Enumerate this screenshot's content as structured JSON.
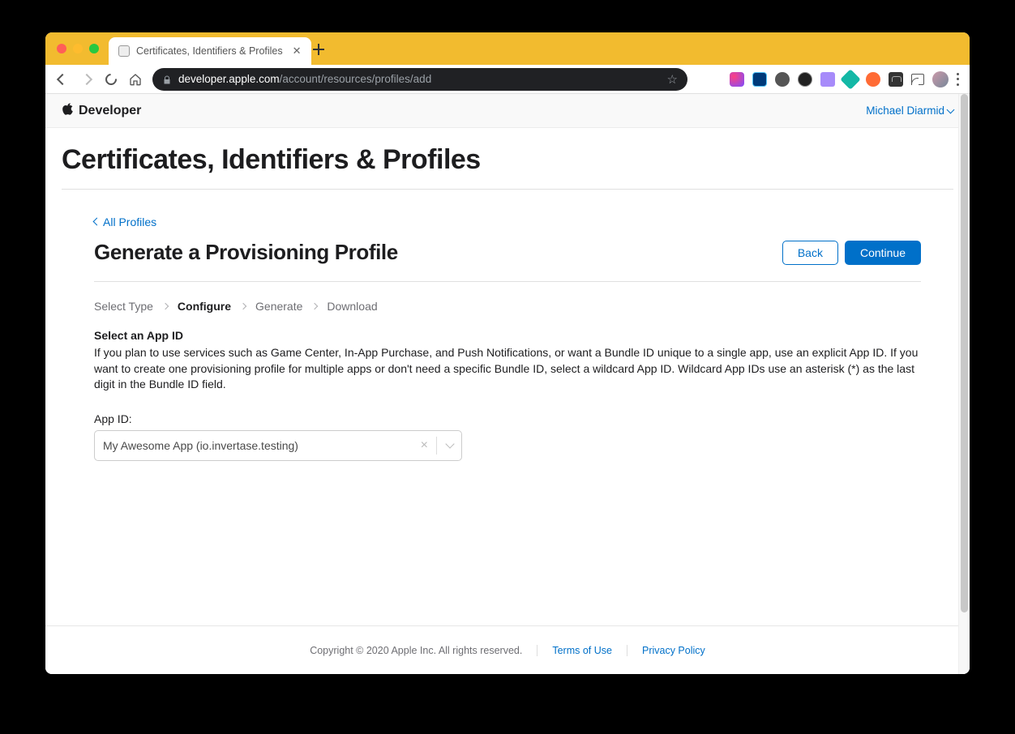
{
  "browser": {
    "tab_title": "Certificates, Identifiers & Profiles",
    "url_host": "developer.apple.com",
    "url_path": "/account/resources/profiles/add"
  },
  "header": {
    "brand": "Developer",
    "user": "Michael Diarmid"
  },
  "page": {
    "title": "Certificates, Identifiers & Profiles",
    "back_link": "All Profiles",
    "subtitle": "Generate a Provisioning Profile",
    "back_button": "Back",
    "continue_button": "Continue"
  },
  "steps": {
    "s1": "Select Type",
    "s2": "Configure",
    "s3": "Generate",
    "s4": "Download"
  },
  "section": {
    "label": "Select an App ID",
    "description": "If you plan to use services such as Game Center, In-App Purchase, and Push Notifications, or want a Bundle ID unique to a single app, use an explicit App ID. If you want to create one provisioning profile for multiple apps or don't need a specific Bundle ID, select a wildcard App ID. Wildcard App IDs use an asterisk (*) as the last digit in the Bundle ID field."
  },
  "field": {
    "label": "App ID:",
    "value": "My Awesome App (io.invertase.testing)"
  },
  "footer": {
    "copyright": "Copyright © 2020 Apple Inc. All rights reserved.",
    "terms": "Terms of Use",
    "privacy": "Privacy Policy"
  }
}
